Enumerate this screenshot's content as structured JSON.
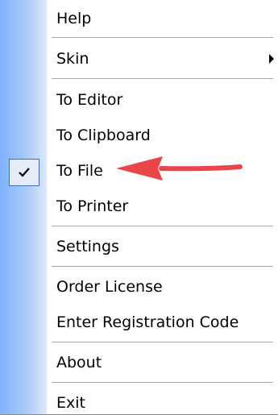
{
  "menu": {
    "items": {
      "help": "Help",
      "skin": "Skin",
      "to_editor": "To Editor",
      "to_clipboard": "To Clipboard",
      "to_file": "To File",
      "to_printer": "To Printer",
      "settings": "Settings",
      "order_license": "Order License",
      "enter_registration_code": "Enter Registration Code",
      "about": "About",
      "exit": "Exit"
    },
    "checked_item": "to_file",
    "submenu_item": "skin"
  },
  "colors": {
    "gutter": "#a9c9f5",
    "check_highlight": "#e6ebf8",
    "check_border": "#3d6cc0",
    "annotation_arrow": "#e8464a"
  },
  "icons": {
    "check": "check-icon",
    "submenu": "chevron-right-icon",
    "annotation": "red-arrow-annotation"
  }
}
